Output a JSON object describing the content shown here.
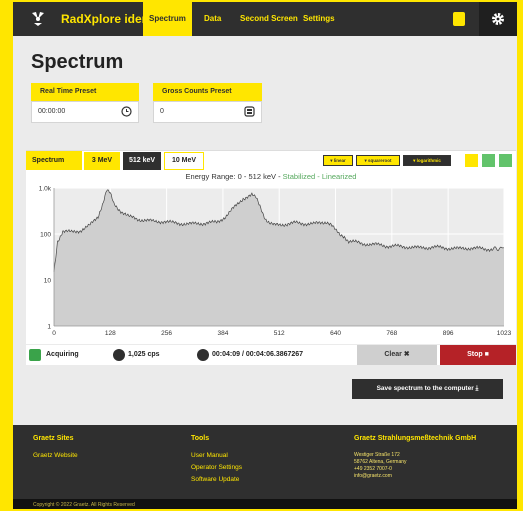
{
  "app": {
    "brand": "RadXplore ident",
    "nav_tabs": [
      {
        "label": "Spectrum",
        "active": true
      },
      {
        "label": "Data"
      },
      {
        "label": "Second Screen"
      },
      {
        "label": "Settings"
      }
    ]
  },
  "page_title": "Spectrum",
  "presets": {
    "real_time": {
      "label": "Real Time Preset",
      "value": "00:00:00"
    },
    "gross_counts": {
      "label": "Gross Counts Preset",
      "value": "0"
    }
  },
  "spectrum_bar": {
    "label": "Spectrum",
    "ranges": [
      "3 MeV",
      "512 keV",
      "10 MeV"
    ],
    "active_range": "512 keV",
    "scales": [
      "linear",
      "squareroot",
      "logarithmic"
    ],
    "active_scale": "logarithmic"
  },
  "chart_header": {
    "prefix": "Energy Range: 0 - 512 keV - ",
    "status": "Stabilized - Linearized"
  },
  "chart_data": {
    "type": "area",
    "title": "Energy Range: 0 - 512 keV - Stabilized - Linearized",
    "xlim": [
      0,
      1023
    ],
    "ylim": [
      1,
      1000
    ],
    "yscale": "log",
    "x_ticks": [
      0,
      128,
      256,
      384,
      512,
      640,
      768,
      896,
      1023
    ],
    "y_ticks": [
      {
        "value": 1,
        "label": "1"
      },
      {
        "value": 10,
        "label": "10"
      },
      {
        "value": 100,
        "label": "100"
      },
      {
        "value": 1000,
        "label": "1.0k"
      }
    ],
    "series": [
      {
        "x": [
          0,
          8,
          20,
          40,
          60,
          80,
          100,
          112,
          120,
          128,
          136,
          150,
          170,
          190,
          210,
          230,
          250,
          270,
          290,
          310,
          330,
          350,
          370,
          390,
          410,
          430,
          450,
          460,
          470,
          480,
          490,
          500,
          512,
          530,
          550,
          570,
          590,
          610,
          620,
          630,
          640,
          650,
          660,
          670,
          680,
          690,
          700,
          720,
          740,
          760,
          780,
          800,
          830,
          860,
          890,
          920,
          950,
          980,
          1000,
          1023
        ],
        "y": [
          15,
          70,
          115,
          110,
          120,
          150,
          240,
          500,
          900,
          750,
          450,
          330,
          240,
          210,
          200,
          185,
          190,
          175,
          170,
          165,
          170,
          175,
          180,
          240,
          380,
          600,
          700,
          600,
          380,
          220,
          170,
          155,
          160,
          165,
          175,
          170,
          165,
          180,
          185,
          160,
          120,
          95,
          90,
          70,
          68,
          65,
          62,
          60,
          58,
          55,
          54,
          53,
          50,
          52,
          50,
          48,
          50,
          47,
          48,
          50
        ]
      }
    ],
    "colors": {
      "fill": "#cfcfcf",
      "line": "#444444"
    }
  },
  "acquisition": {
    "state": "Acquiring",
    "rate": "1,025 cps",
    "time": "00:04:09 / 00:04:06.3867267",
    "clear_label": "Clear ✖",
    "stop_label": "Stop ■"
  },
  "save_label": "Save spectrum to the computer ⤓",
  "footer": {
    "col1": {
      "title": "Graetz Sites",
      "links": [
        "Graetz Website"
      ]
    },
    "col2": {
      "title": "Tools",
      "links": [
        "User Manual",
        "Operator Settings",
        "Software Update"
      ]
    },
    "col3": {
      "title": "Graetz Strahlungsmeßtechnik GmbH",
      "lines": [
        "Westiger Straße 172",
        "58762 Altena, Germany",
        "+49 2352 7007-0",
        "info@graetz.com"
      ]
    },
    "copyright": "Copyright © 2022 Graetz. All Rights Reserved"
  },
  "colors": {
    "accent": "#ffe600",
    "dark": "#2f2f2f",
    "stop": "#b52227",
    "status_green": "#55a85d"
  }
}
